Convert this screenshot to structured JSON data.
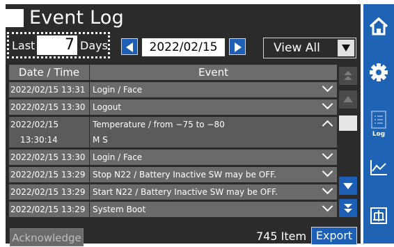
{
  "title": "Event Log",
  "filter": {
    "last_label": "Last",
    "days_value": "7",
    "days_label": "Days",
    "date": "2022/02/15",
    "view_option": "View All"
  },
  "table": {
    "headers": {
      "date": "Date / Time",
      "event": "Event"
    },
    "rows": [
      {
        "date": "2022/02/15 13:31",
        "event": "Login / Face"
      },
      {
        "date": "2022/02/15 13:30",
        "event": "Logout"
      },
      {
        "date": "2022/02/15",
        "date2": "13:30:14",
        "event": "Temperature / from −75 to −80",
        "event2": "M S"
      },
      {
        "date": "2022/02/15 13:30",
        "event": "Login / Face"
      },
      {
        "date": "2022/02/15 13:29",
        "event": "Stop N22 / Battery Inactive SW may be OFF."
      },
      {
        "date": "2022/02/15 13:29",
        "event": "Start N22 / Battery Inactive SW may be OFF."
      },
      {
        "date": "2022/02/15 13:29",
        "event": "System Boot"
      }
    ]
  },
  "footer": {
    "acknowledge": "Acknowledge",
    "item_count": "745 Item",
    "export": "Export"
  },
  "nav": {
    "items": [
      {
        "icon": "home-icon"
      },
      {
        "icon": "gear-icon"
      },
      {
        "icon": "log-icon",
        "label": "Log"
      },
      {
        "icon": "chart-icon"
      },
      {
        "icon": "network-icon"
      }
    ]
  },
  "colors": {
    "accent": "#1f63b4",
    "panel": "#2b2b2b",
    "row": "#6a6a6a"
  }
}
